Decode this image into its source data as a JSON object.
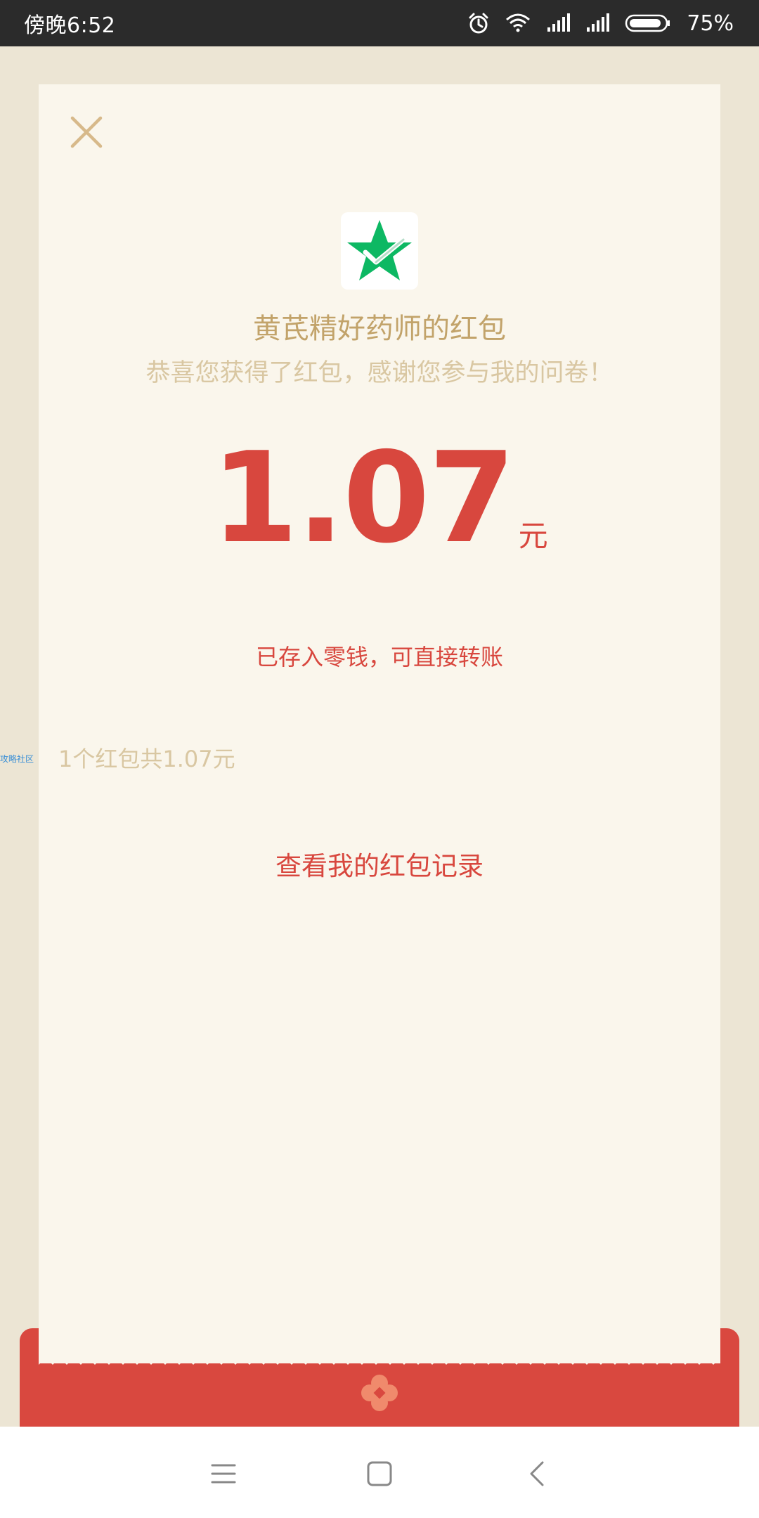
{
  "status_bar": {
    "time": "傍晚6:52",
    "battery_percent": "75%",
    "icons": [
      "alarm-icon",
      "wifi-icon",
      "signal-icon",
      "signal-icon",
      "battery-icon"
    ]
  },
  "card": {
    "close_icon": "close-icon",
    "logo_icon": "green-star-check-icon",
    "sender_name": "黄芪精好药师的红包",
    "greeting": "恭喜您获得了红包，感谢您参与我的问卷！",
    "amount": "1.07",
    "amount_unit": "元",
    "stored_note": "已存入零钱，可直接转账",
    "summary": "1个红包共1.07元",
    "records_link": "查看我的红包记录"
  },
  "side_badge": "攻略社区",
  "nav_bar": {
    "icons": [
      "menu-icon",
      "home-icon",
      "back-icon"
    ]
  },
  "colors": {
    "accent_red": "#D8473E",
    "gold_text": "#C2A36A",
    "light_gold_text": "#D9C7A2",
    "card_background": "#FAF6EC",
    "page_background": "#ECE5D4"
  }
}
